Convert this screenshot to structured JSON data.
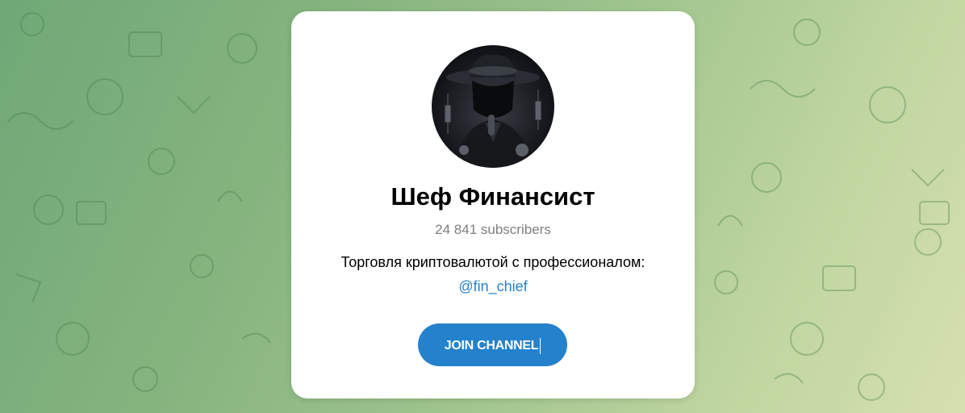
{
  "channel": {
    "title": "Шеф Финансист",
    "subscribers": "24 841 subscribers",
    "description": "Торговля криптовалютой с профессионалом:",
    "username": "@fin_chief",
    "join_label": "JOIN CHANNEL"
  },
  "colors": {
    "accent": "#2481cc",
    "background_start": "#6fa877",
    "background_end": "#d6e0b0"
  },
  "icons": {
    "avatar": "hooded-figure-avatar",
    "background": "doodle-pattern"
  }
}
